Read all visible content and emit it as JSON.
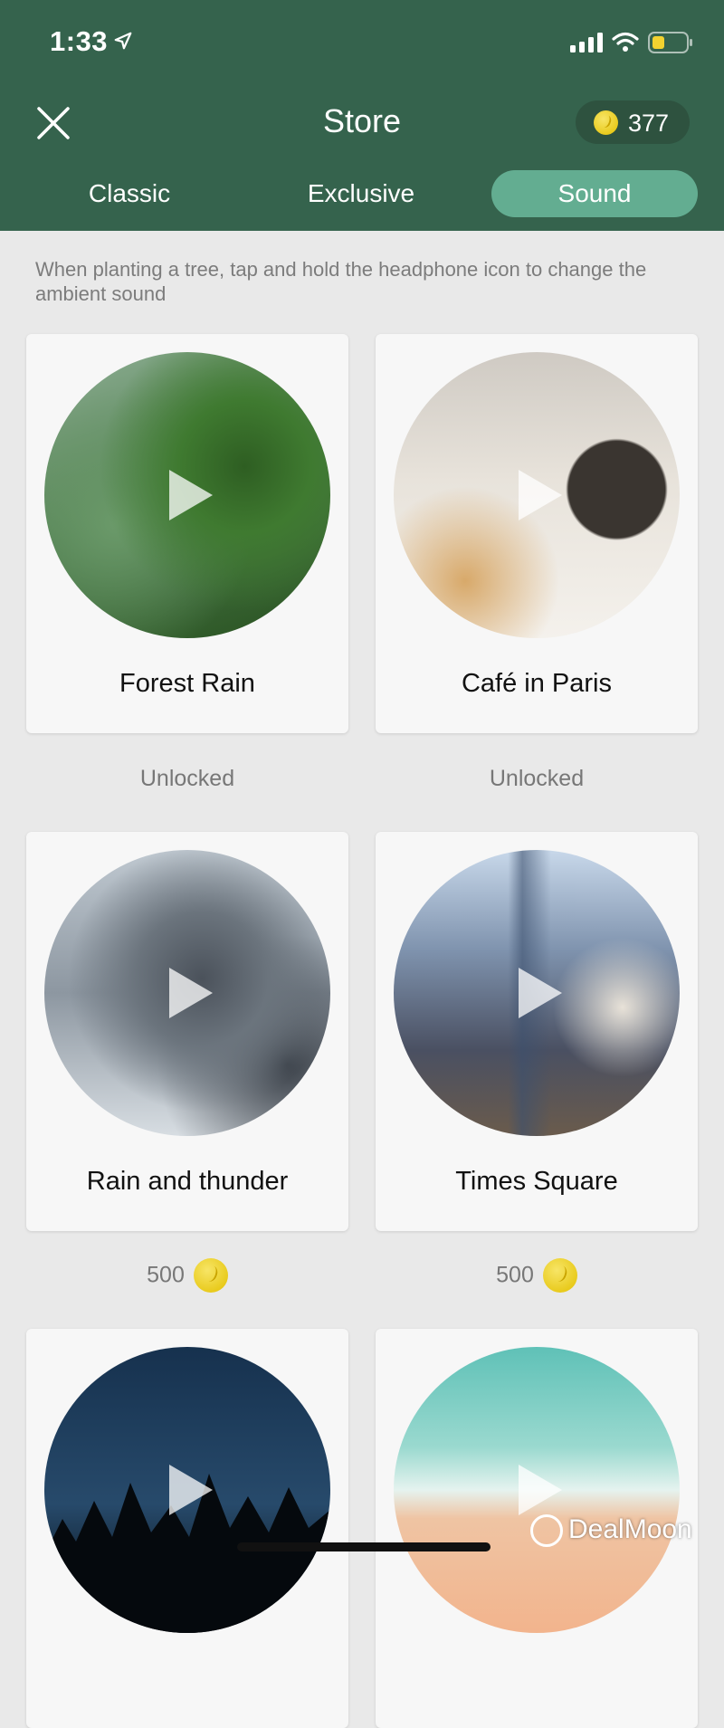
{
  "status_bar": {
    "time": "1:33",
    "icons": [
      "location-arrow-icon",
      "cellular-signal-icon",
      "wifi-icon",
      "battery-low-icon"
    ],
    "battery_color": "#f2d230"
  },
  "header": {
    "title": "Store",
    "close_icon": "close-icon",
    "coin_balance": "377",
    "background": "#35634d"
  },
  "tabs": [
    {
      "label": "Classic",
      "active": false
    },
    {
      "label": "Exclusive",
      "active": false
    },
    {
      "label": "Sound",
      "active": true
    }
  ],
  "colors": {
    "accent": "#63ad91",
    "coin": "#e8c81a",
    "page_background": "#e9e9e9"
  },
  "hint": "When planting a tree, tap and hold the headphone icon to change the ambient sound",
  "sounds": [
    {
      "name": "Forest Rain",
      "status": "Unlocked",
      "price": null
    },
    {
      "name": "Café in Paris",
      "status": "Unlocked",
      "price": null
    },
    {
      "name": "Rain and thunder",
      "status": null,
      "price": "500"
    },
    {
      "name": "Times Square",
      "status": null,
      "price": "500"
    },
    {
      "name": "",
      "status": null,
      "price": null
    },
    {
      "name": "",
      "status": null,
      "price": null
    }
  ],
  "watermark": "DealMoon"
}
